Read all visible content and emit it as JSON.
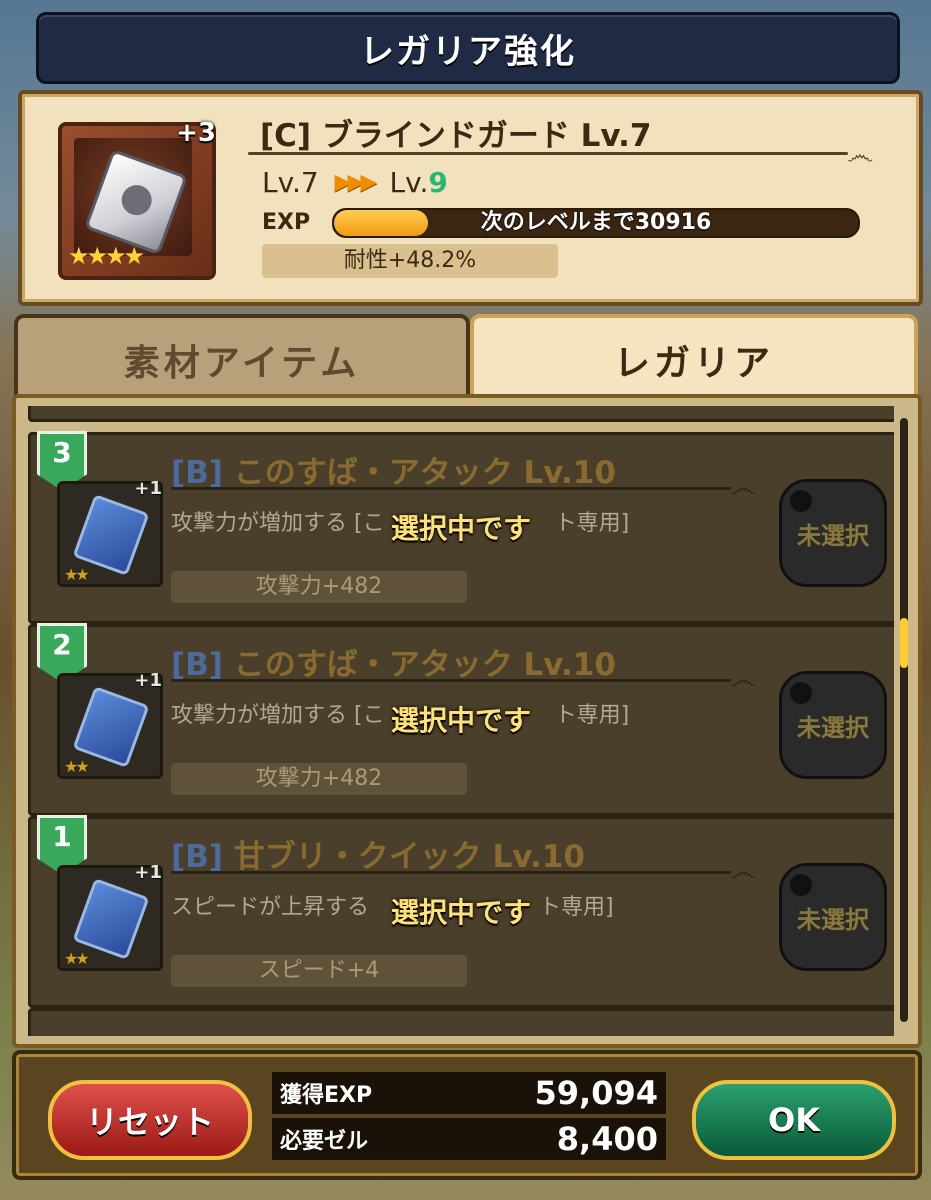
{
  "title": "レガリア強化",
  "header": {
    "plus": "+3",
    "stars": "★★★★",
    "name": "[C] ブラインドガード Lv.7",
    "lv_current": "Lv.7",
    "arrows": "▶▶▶",
    "lv_next_prefix": "Lv.",
    "lv_next_value": "9",
    "exp_label": "EXP",
    "exp_text": "次のレベルまで30916",
    "exp_progress": 0.18,
    "stat": "耐性+48.2%"
  },
  "tabs": [
    {
      "label": "素材アイテム",
      "active": false
    },
    {
      "label": "レガリア",
      "active": true
    }
  ],
  "items": [
    {
      "rank": "3",
      "rank_tag": "[B]",
      "name": "このすば・アタック Lv.10",
      "desc": "攻撃力が増加する [こ",
      "desc_tail": "ト専用]",
      "stat": "攻撃力+482",
      "plus": "+1",
      "stars": "★★",
      "selected_text": "選択中です",
      "button": "未選択"
    },
    {
      "rank": "2",
      "rank_tag": "[B]",
      "name": "このすば・アタック Lv.10",
      "desc": "攻撃力が増加する [こ",
      "desc_tail": "ト専用]",
      "stat": "攻撃力+482",
      "plus": "+1",
      "stars": "★★",
      "selected_text": "選択中です",
      "button": "未選択"
    },
    {
      "rank": "1",
      "rank_tag": "[B]",
      "name": "甘ブリ・クイック Lv.10",
      "desc": "スピードが上昇する",
      "desc_tail": "ト専用]",
      "stat": "スピード+4",
      "plus": "+1",
      "stars": "★★",
      "selected_text": "選択中です",
      "button": "未選択"
    }
  ],
  "footer": {
    "reset_label": "リセット",
    "ok_label": "OK",
    "exp_label": "獲得EXP",
    "exp_value": "59,094",
    "zel_label": "必要ゼル",
    "zel_value": "8,400"
  }
}
